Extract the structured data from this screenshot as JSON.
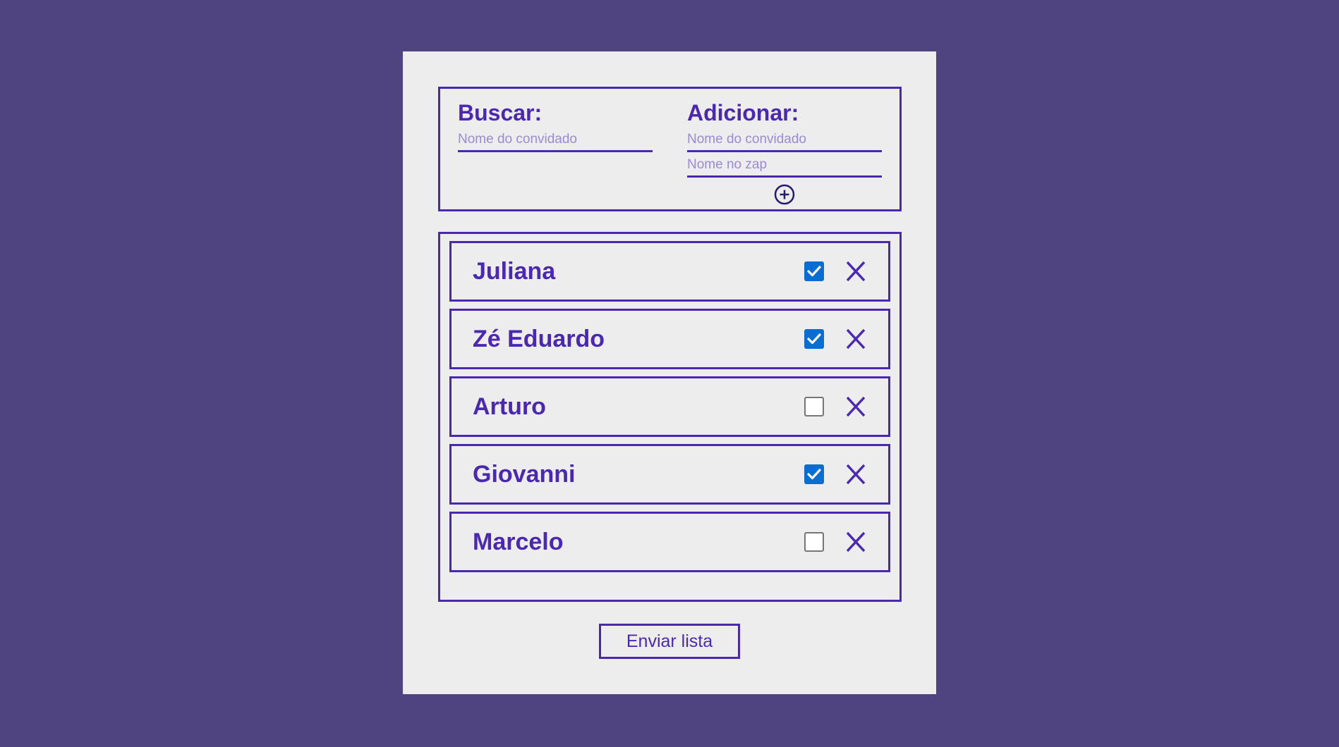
{
  "search": {
    "heading": "Buscar:",
    "placeholder": "Nome do convidado"
  },
  "add": {
    "heading": "Adicionar:",
    "name_placeholder": "Nome do convidado",
    "zap_placeholder": "Nome no zap",
    "add_icon": "plus-circle-icon"
  },
  "guests": [
    {
      "name": "Juliana",
      "checked": true
    },
    {
      "name": "Zé Eduardo",
      "checked": true
    },
    {
      "name": "Arturo",
      "checked": false
    },
    {
      "name": "Giovanni",
      "checked": true
    },
    {
      "name": "Marcelo",
      "checked": false
    }
  ],
  "remove_icon": "close-icon",
  "send_label": "Enviar lista",
  "colors": {
    "background": "#4f447f",
    "card": "#ededee",
    "accent": "#4a28b4",
    "checkbox_checked": "#0a6dd1"
  }
}
